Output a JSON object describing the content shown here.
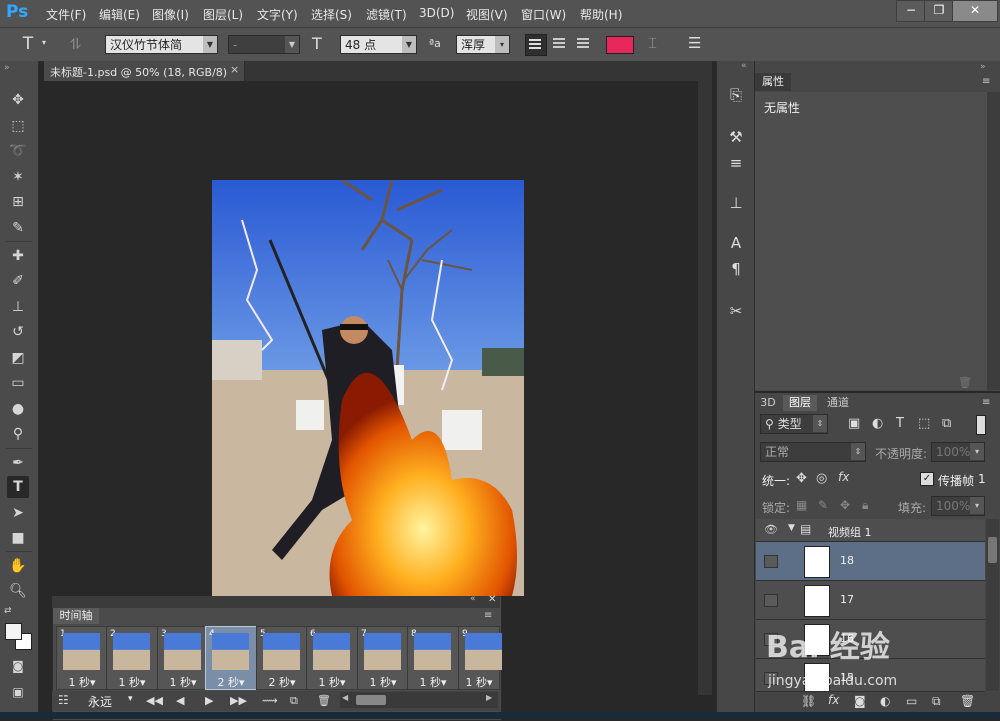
{
  "app": {
    "logo": "Ps"
  },
  "menu": [
    "文件(F)",
    "编辑(E)",
    "图像(I)",
    "图层(L)",
    "文字(Y)",
    "选择(S)",
    "滤镜(T)",
    "3D(D)",
    "视图(V)",
    "窗口(W)",
    "帮助(H)"
  ],
  "window_controls": {
    "minimize": "−",
    "restore": "❐",
    "close": "✕"
  },
  "options": {
    "tool_glyph": "T",
    "font_family": "汉仪竹节体简",
    "font_style": "-",
    "font_size": "48 点",
    "aa_label": "ªa",
    "antialias": "浑厚",
    "text_color": "#e8285a"
  },
  "document_tab": {
    "title": "未标题-1.psd @ 50% (18, RGB/8)",
    "close": "×"
  },
  "properties_panel": {
    "tab": "属性",
    "content": "无属性"
  },
  "layers_panel": {
    "tabs": [
      "3D",
      "图层",
      "通道"
    ],
    "filter_kind": "类型",
    "blend_mode": "正常",
    "opacity_label": "不透明度:",
    "opacity_value": "100%",
    "unify_label": "统一:",
    "propagate_label": "传播帧",
    "propagate_value": "1",
    "lock_label": "锁定:",
    "fill_label": "填充:",
    "fill_value": "100%",
    "group_name": "视频组 1",
    "layers": [
      "18",
      "17",
      "16",
      "15"
    ]
  },
  "timeline": {
    "tab": "时间轴",
    "frames": [
      {
        "num": "1",
        "delay": "1 秒▾"
      },
      {
        "num": "2",
        "delay": "1 秒▾"
      },
      {
        "num": "3",
        "delay": "1 秒▾"
      },
      {
        "num": "4",
        "delay": "2 秒▾"
      },
      {
        "num": "5",
        "delay": "2 秒▾"
      },
      {
        "num": "6",
        "delay": "1 秒▾"
      },
      {
        "num": "7",
        "delay": "1 秒▾"
      },
      {
        "num": "8",
        "delay": "1 秒▾"
      },
      {
        "num": "9",
        "delay": "1 秒▾"
      }
    ],
    "selected_frame": 4,
    "loop": "永远"
  },
  "watermark": {
    "brand": "Bai 经验",
    "url": "jingyan.baidu.com"
  }
}
